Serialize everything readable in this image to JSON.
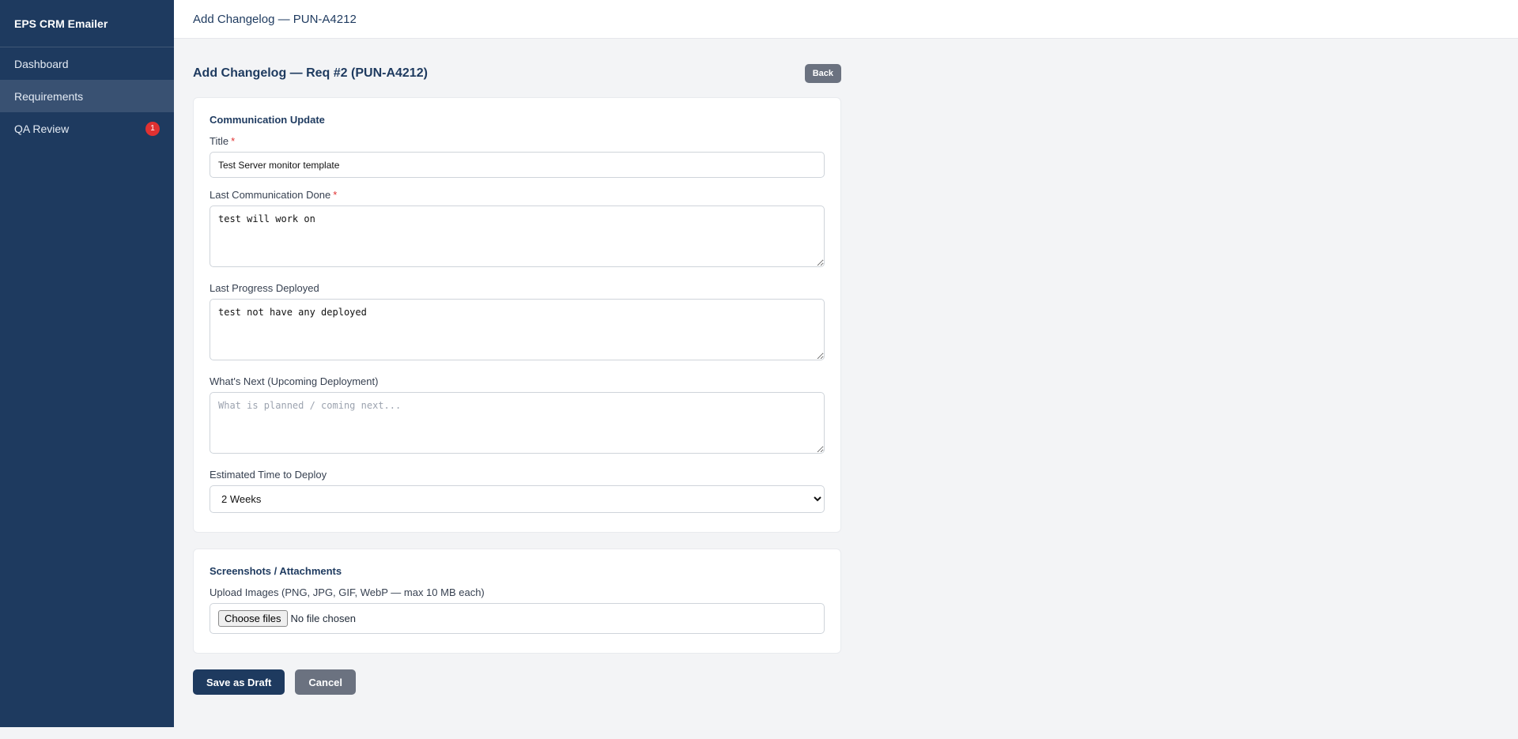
{
  "app": {
    "brand": "EPS CRM Emailer"
  },
  "sidebar": {
    "items": [
      {
        "label": "Dashboard"
      },
      {
        "label": "Requirements"
      },
      {
        "label": "QA Review",
        "badge": "1"
      }
    ]
  },
  "topbar": {
    "title": "Add Changelog — PUN-A4212"
  },
  "page": {
    "title": "Add Changelog — Req #2 (PUN-A4212)",
    "back_label": "Back"
  },
  "communication": {
    "section_title": "Communication Update",
    "title_label": "Title",
    "title_value": "Test Server monitor template",
    "last_comm_label": "Last Communication Done",
    "last_comm_value": "test will work on",
    "last_progress_label": "Last Progress Deployed",
    "last_progress_value": "test not have any deployed",
    "whats_next_label": "What's Next (Upcoming Deployment)",
    "whats_next_placeholder": "What is planned / coming next...",
    "whats_next_value": "",
    "eta_label": "Estimated Time to Deploy",
    "eta_selected": "2 Weeks",
    "required_mark": "*"
  },
  "attachments": {
    "section_title": "Screenshots / Attachments",
    "upload_label": "Upload Images (PNG, JPG, GIF, WebP — max 10 MB each)",
    "choose_label": "Choose files",
    "no_file_text": "No file chosen"
  },
  "actions": {
    "save_draft": "Save as Draft",
    "cancel": "Cancel"
  },
  "colors": {
    "sidebar_bg": "#1e3a5f",
    "accent": "#1e3a5f",
    "badge": "#e03131",
    "secondary_btn": "#6b7280"
  }
}
